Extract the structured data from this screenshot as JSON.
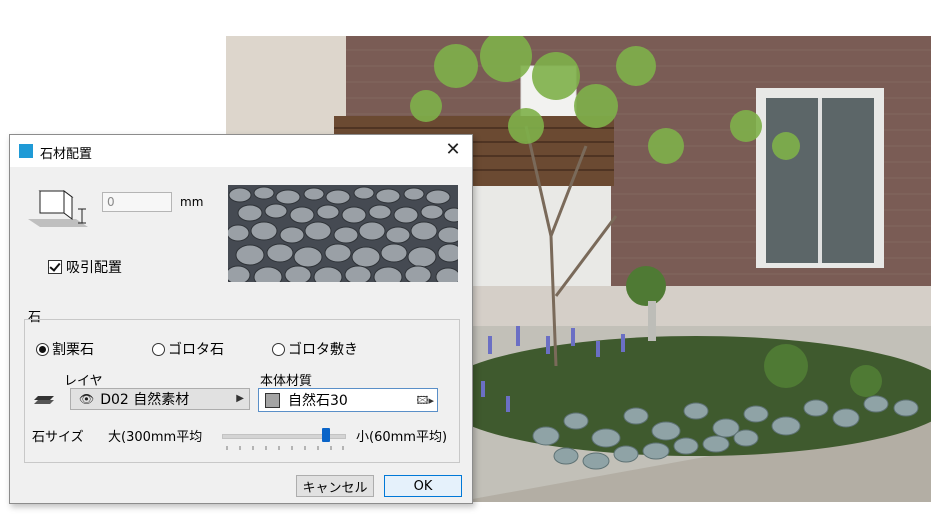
{
  "dialog": {
    "title": "石材配置",
    "thickness_value": "0",
    "thickness_unit": "mm",
    "snap_checkbox": {
      "label": "吸引配置",
      "checked": true
    },
    "stone_group": {
      "label": "石",
      "options": [
        {
          "label": "割栗石",
          "selected": true
        },
        {
          "label": "ゴロタ石",
          "selected": false
        },
        {
          "label": "ゴロタ敷き",
          "selected": false
        }
      ]
    },
    "layer": {
      "label": "レイヤ",
      "value": "D02 自然素材"
    },
    "material": {
      "label": "本体材質",
      "value": "自然石30"
    },
    "stone_size": {
      "label": "石サイズ",
      "large_label": "大(300mm平均",
      "small_label": "小(60mm平均)",
      "slider_fraction": 0.85
    },
    "buttons": {
      "cancel": "キャンセル",
      "ok": "OK"
    }
  },
  "colors": {
    "accent": "#0078d7",
    "app_icon": "#1f9ad6",
    "brick": "#7a5c55"
  }
}
